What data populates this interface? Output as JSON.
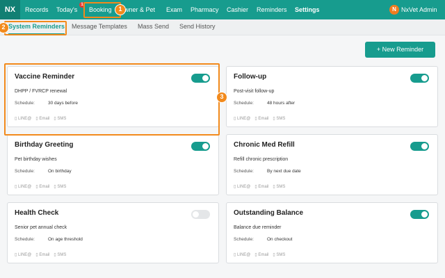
{
  "nav": {
    "logo": "NX",
    "items": [
      "Records",
      "Today's",
      "Booking",
      "Owner & Pet",
      "Exam",
      "Pharmacy",
      "Cashier",
      "Reminders",
      "Settings"
    ],
    "notif_count": "1",
    "user_initial": "N",
    "user_name": "NxVet Admin"
  },
  "subnav": {
    "tabs": [
      "System Reminders",
      "Message Templates",
      "Mass Send",
      "Send History"
    ]
  },
  "actions": {
    "new_reminder": "+ New Reminder"
  },
  "common": {
    "schedule_label": "Schedule:",
    "channels": [
      "▯ LINE@",
      "▯ Email",
      "▯ SMS"
    ]
  },
  "cards": [
    {
      "title": "Vaccine Reminder",
      "desc": "DHPP / FVRCP renewal",
      "schedule": "30 days before",
      "enabled": true
    },
    {
      "title": "Follow-up",
      "desc": "Post-visit follow-up",
      "schedule": "48 hours after",
      "enabled": true
    },
    {
      "title": "Birthday Greeting",
      "desc": "Pet birthday wishes",
      "schedule": "On birthday",
      "enabled": true
    },
    {
      "title": "Chronic Med Refill",
      "desc": "Refill chronic prescription",
      "schedule": "By next due date",
      "enabled": true
    },
    {
      "title": "Health Check",
      "desc": "Senior pet annual check",
      "schedule": "On age threshold",
      "enabled": false
    },
    {
      "title": "Outstanding Balance",
      "desc": "Balance due reminder",
      "schedule": "On checkout",
      "enabled": true
    }
  ],
  "tutorial": {
    "steps": [
      "1",
      "2",
      "3"
    ],
    "accent": "#f28a1c"
  },
  "colors": {
    "brand": "#179c8e",
    "accent": "#f28a1c",
    "badge": "#e53935"
  }
}
